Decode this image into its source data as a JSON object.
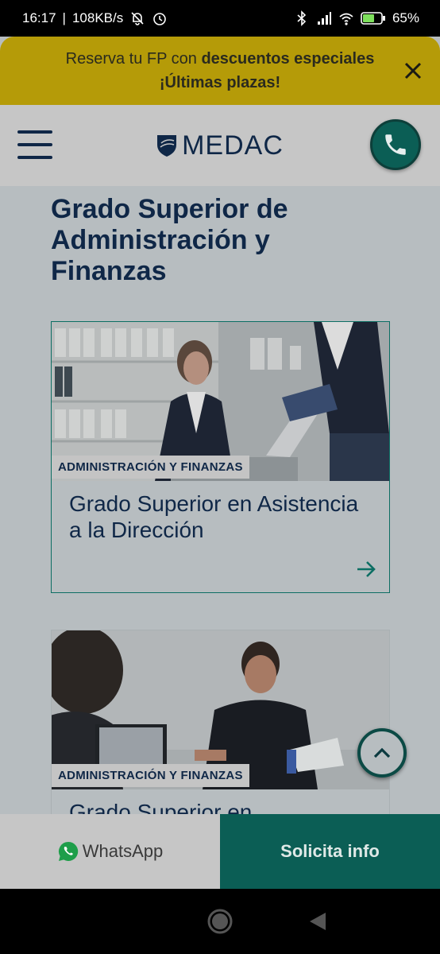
{
  "status_bar": {
    "time": "16:17",
    "network_speed": "108KB/s",
    "battery": "65%",
    "icons": [
      "bell-off-icon",
      "alarm-icon",
      "bluetooth-icon",
      "signal-icon",
      "wifi-icon",
      "battery-icon"
    ]
  },
  "promo": {
    "text_part1": "Reserva tu FP con ",
    "text_bold": "descuentos especiales",
    "text_line2": "¡Últimas plazas!",
    "close_icon": "close-icon"
  },
  "header": {
    "logo_text": "MEDAC",
    "menu_icon": "hamburger-menu-icon",
    "call_icon": "phone-icon"
  },
  "main": {
    "page_title": "Grado Superior de Administración y Finanzas",
    "cards": [
      {
        "tag": "ADMINISTRACIÓN Y FINANZAS",
        "title": "Grado Superior en Asistencia a la Dirección",
        "arrow_icon": "arrow-right-icon"
      },
      {
        "tag": "ADMINISTRACIÓN Y FINANZAS",
        "title": "Grado Superior en"
      }
    ]
  },
  "cta": {
    "whatsapp_label": "WhatsApp",
    "info_label": "Solicita info"
  },
  "colors": {
    "brand_navy": "#0f2747",
    "brand_teal": "#0b5e55",
    "promo_yellow": "#b59b08"
  }
}
